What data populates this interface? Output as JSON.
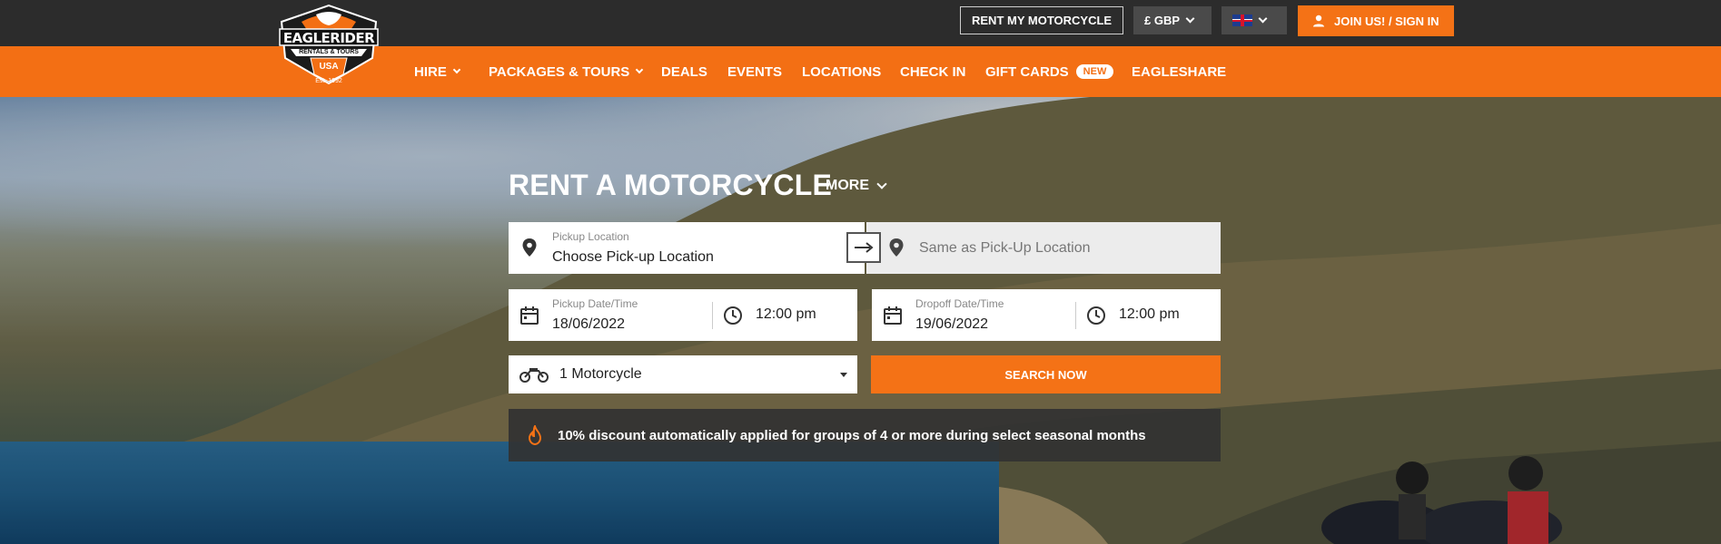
{
  "topbar": {
    "rent_my_motorcycle": "RENT MY MOTORCYCLE",
    "currency": "£ GBP",
    "join_sign_in": "JOIN US! / SIGN IN"
  },
  "logo": {
    "brand": "EAGLERIDER",
    "tagline": "RENTALS & TOURS",
    "country": "USA",
    "est": "Est. 1992"
  },
  "nav": {
    "items": [
      {
        "label": "HIRE"
      },
      {
        "label": "PACKAGES & TOURS"
      },
      {
        "label": "DEALS"
      },
      {
        "label": "EVENTS"
      },
      {
        "label": "LOCATIONS"
      },
      {
        "label": "CHECK IN"
      },
      {
        "label": "GIFT CARDS"
      },
      {
        "label": "EAGLESHARE"
      }
    ],
    "new_badge": "NEW"
  },
  "booking": {
    "title": "RENT A MOTORCYCLE",
    "more": "MORE",
    "pickup_location_label": "Pickup Location",
    "pickup_location_value": "Choose Pick-up Location",
    "dropoff_location_placeholder": "Same as Pick-Up Location",
    "pickup_datetime_label": "Pickup Date/Time",
    "pickup_date": "18/06/2022",
    "pickup_time": "12:00 pm",
    "dropoff_datetime_label": "Dropoff Date/Time",
    "dropoff_date": "19/06/2022",
    "dropoff_time": "12:00 pm",
    "motorcycles": "1 Motorcycle",
    "search": "SEARCH NOW",
    "promo": "10% discount automatically applied for groups of 4 or more during select seasonal months"
  },
  "colors": {
    "brand_orange": "#f36f14",
    "dark_bar": "#2c2c2c"
  }
}
